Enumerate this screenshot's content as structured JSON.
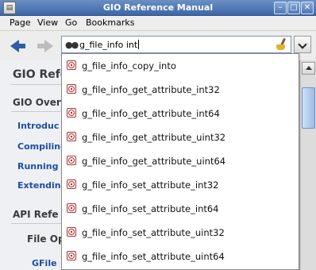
{
  "window": {
    "title": "GIO Reference Manual",
    "controls": {
      "minimize": "–",
      "maximize": "□",
      "close": "✕"
    }
  },
  "menu": {
    "items": [
      "Page",
      "View",
      "Go",
      "Bookmarks"
    ]
  },
  "toolbar": {
    "search_value": "g_file_info int"
  },
  "content": {
    "heading_main": "GIO Refe",
    "heading_overview": "GIO Over",
    "links": [
      "Introduc",
      "Compiling",
      "Running",
      "Extendin"
    ],
    "heading_api": "API Refe",
    "heading_fileops": "File Op",
    "link_gfile": "GFile"
  },
  "suggestions": [
    "g_file_info_copy_into",
    "g_file_info_get_attribute_int32",
    "g_file_info_get_attribute_int64",
    "g_file_info_get_attribute_uint32",
    "g_file_info_get_attribute_uint64",
    "g_file_info_set_attribute_int32",
    "g_file_info_set_attribute_int64",
    "g_file_info_set_attribute_uint32",
    "g_file_info_set_attribute_uint64"
  ],
  "icons": {
    "app": "app-icon",
    "back": "back-arrow-icon",
    "forward": "forward-arrow-icon",
    "search": "binoculars-icon",
    "clear": "broom-clear-icon",
    "dropdown": "chevron-down-icon",
    "suggestion": "function-icon"
  },
  "colors": {
    "titlebar": "#3b67a9",
    "link": "#1f4ea0",
    "back_arrow": "#2f5ea6"
  }
}
